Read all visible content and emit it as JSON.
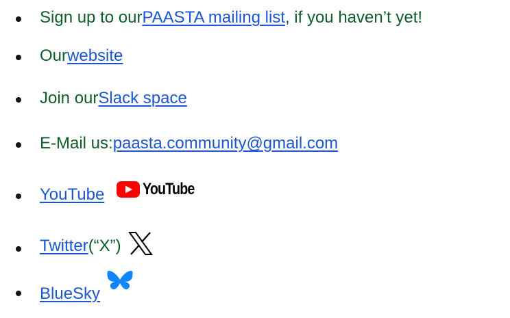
{
  "items": [
    {
      "prefix": "Sign up to our ",
      "link": "PAASTA mailing list",
      "suffix": ", if you haven’t yet!"
    },
    {
      "prefix": "Our ",
      "link": "website"
    },
    {
      "prefix": "Join our ",
      "link": "Slack space"
    },
    {
      "prefix": "E-Mail us: ",
      "link": "paasta.community@gmail.com"
    },
    {
      "link": "YouTube",
      "logo_text": "YouTube",
      "logo_icon": "youtube-play-icon"
    },
    {
      "link": "Twitter",
      "suffix": " (“X”)",
      "logo_icon": "x-logo-icon"
    },
    {
      "link": "BlueSky",
      "logo_icon": "bluesky-butterfly-icon"
    }
  ],
  "colors": {
    "text": "#0d5c2a",
    "link": "#1a55d4",
    "youtube_red": "#ff0000",
    "bluesky_blue": "#1185fe"
  }
}
